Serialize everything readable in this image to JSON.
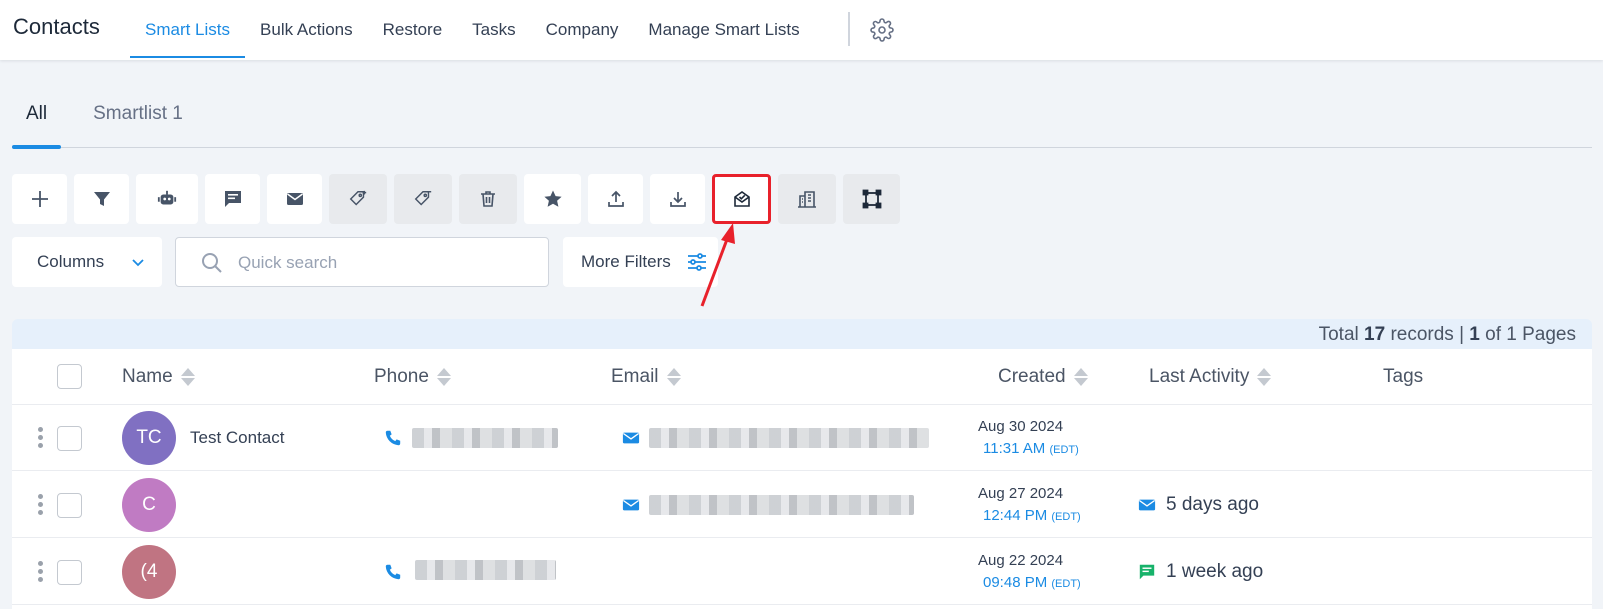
{
  "header": {
    "title": "Contacts",
    "nav": [
      "Smart Lists",
      "Bulk Actions",
      "Restore",
      "Tasks",
      "Company",
      "Manage Smart Lists"
    ],
    "active_nav": "Smart Lists"
  },
  "tabs": [
    {
      "label": "All",
      "active": true
    },
    {
      "label": "Smartlist 1",
      "active": false
    }
  ],
  "toolbar": {
    "buttons": [
      "add-icon",
      "filter-icon",
      "robot-icon",
      "chat-icon",
      "mail-icon",
      "tag-add-icon",
      "tag-remove-icon",
      "trash-icon",
      "star-icon",
      "upload-icon",
      "download-icon",
      "envelope-open-icon",
      "building-icon",
      "merge-icon"
    ],
    "highlighted": "envelope-open-icon"
  },
  "filters": {
    "columns_label": "Columns",
    "search_placeholder": "Quick search",
    "more_filters_label": "More Filters"
  },
  "table": {
    "summary": {
      "prefix": "Total",
      "total": "17",
      "middle": "records |",
      "page": "1",
      "suffix": "of 1 Pages"
    },
    "columns": [
      "Name",
      "Phone",
      "Email",
      "Created",
      "Last Activity",
      "Tags"
    ],
    "rows": [
      {
        "initials": "TC",
        "avatar_color": "#8070c2",
        "name": "Test Contact",
        "has_phone": true,
        "has_email": true,
        "created_date": "Aug 30 2024",
        "created_time": "11:31 AM",
        "tz": "(EDT)",
        "activity": "",
        "activity_icon": ""
      },
      {
        "initials": "C",
        "avatar_color": "#c07bc3",
        "name": "",
        "has_phone": false,
        "has_email": true,
        "created_date": "Aug 27 2024",
        "created_time": "12:44 PM",
        "tz": "(EDT)",
        "activity": "5 days ago",
        "activity_icon": "mail-icon"
      },
      {
        "initials": "(4",
        "avatar_color": "#c07482",
        "name": "",
        "has_phone": true,
        "has_email": false,
        "created_date": "Aug 22 2024",
        "created_time": "09:48 PM",
        "tz": "(EDT)",
        "activity": "1 week ago",
        "activity_icon": "sms-icon"
      }
    ]
  },
  "colors": {
    "accent": "#1b8be3",
    "highlight": "#e8212b",
    "sms_green": "#17b26a"
  }
}
